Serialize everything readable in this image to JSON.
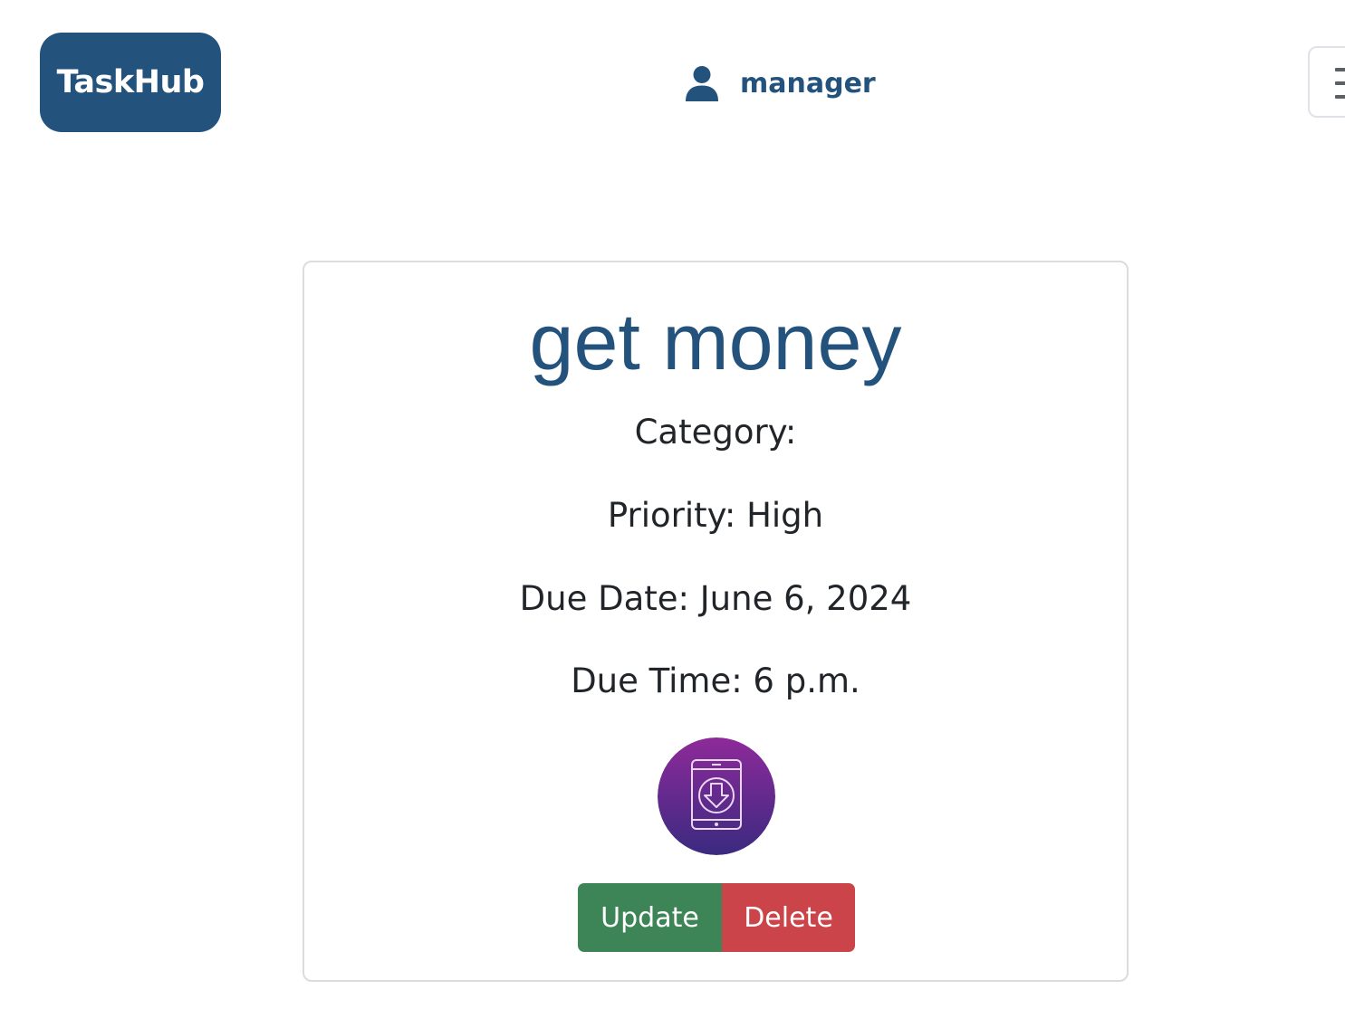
{
  "navbar": {
    "brand": "TaskHub",
    "username": "manager",
    "icons": {
      "user": "user-icon",
      "menu": "hamburger-menu-icon"
    }
  },
  "task": {
    "title": "get money",
    "category_text": "Category:",
    "priority_text": "Priority: High",
    "due_date_text": "Due Date: June 6, 2024",
    "due_time_text": "Due Time: 6 p.m.",
    "image_icon": "phone-download-icon"
  },
  "actions": {
    "update_label": "Update",
    "delete_label": "Delete"
  },
  "colors": {
    "brand": "#23527c",
    "update": "#3d8457",
    "delete": "#cb444a",
    "image_gradient_top": "#8e2a9a",
    "image_gradient_bottom": "#3a2a80"
  }
}
